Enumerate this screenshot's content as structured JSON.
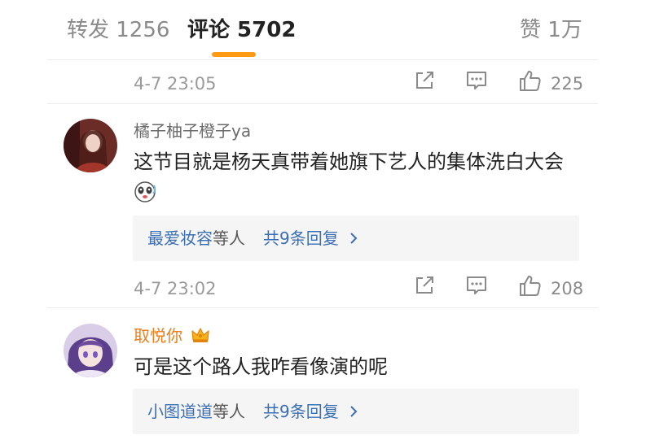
{
  "tabs": {
    "repost": "转发 1256",
    "comments": "评论 5702",
    "likes": "赞 1万"
  },
  "colors": {
    "accent": "#ff9a14",
    "link": "#3a6fb4",
    "vip_name": "#ef7d1a"
  },
  "meta1": {
    "time": "4-7 23:05",
    "likes": "225"
  },
  "comments": [
    {
      "user": "橘子柚子橙子ya",
      "text": "这节目就是杨天真带着她旗下艺人的集体洗白大会",
      "reply_names": "最爱妆容",
      "reply_others": "等人",
      "reply_count": "共9条回复",
      "time": "4-7 23:02",
      "likes": "208"
    },
    {
      "user": "取悦你",
      "badge_icon": "crown-icon",
      "text": "可是这个路人我咋看像演的呢",
      "reply_names": "小图道道",
      "reply_others": "等人",
      "reply_count": "共9条回复"
    }
  ]
}
